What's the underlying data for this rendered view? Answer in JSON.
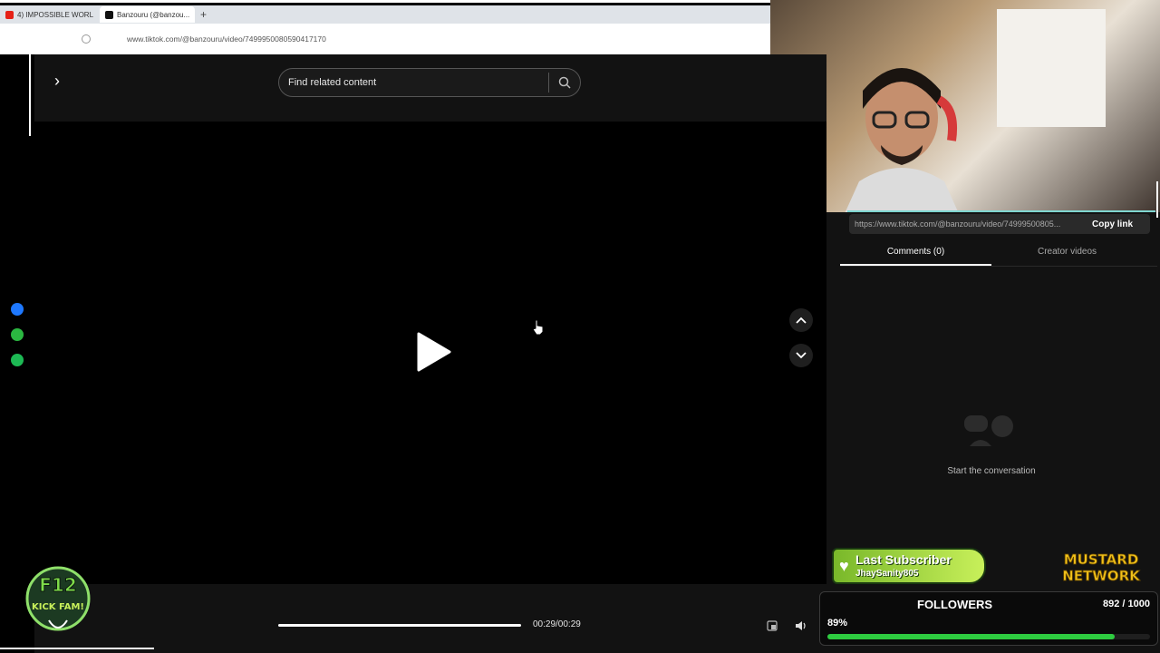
{
  "browser": {
    "tabs": [
      {
        "label": "4) IMPOSSIBLE WORL"
      },
      {
        "label": "Banzouru (@banzou..."
      }
    ],
    "new_tab": "+",
    "url": "www.tiktok.com/@banzouru/video/7499950080590417170"
  },
  "search": {
    "placeholder": "Find related content"
  },
  "player": {
    "time": "00:29/00:29",
    "progress": 1.0
  },
  "panel": {
    "share_url": "https://www.tiktok.com/@banzouru/video/74999500805...",
    "copy_link": "Copy link",
    "tabs": [
      {
        "label": "Comments (0)"
      },
      {
        "label": "Creator videos"
      }
    ],
    "empty_text": "Start the conversation"
  },
  "overlay": {
    "last_subscriber_title": "Last Subscriber",
    "last_subscriber_name": "JhaySanity805",
    "followers_title": "FOLLOWERS",
    "followers_count": "892 / 1000",
    "followers_percent": "89%",
    "followers_progress": 0.89
  },
  "colors": {
    "accent_green": "#2ecc40",
    "tiktok_bg": "#121212"
  }
}
